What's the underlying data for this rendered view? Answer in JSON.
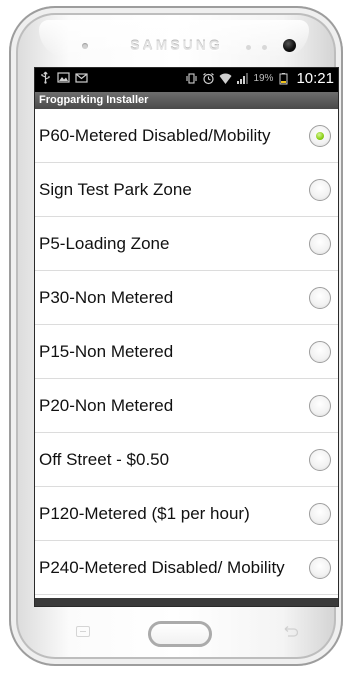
{
  "device": {
    "brand": "SAMSUNG"
  },
  "status_bar": {
    "left_icons": [
      "usb-icon",
      "image-icon",
      "mail-icon"
    ],
    "right_icons": [
      "vibrate-icon",
      "alarm-icon",
      "wifi-icon",
      "signal-icon",
      "battery-icon"
    ],
    "battery_percent": "19%",
    "time": "10:21"
  },
  "app": {
    "title": "Frogparking Installer"
  },
  "list": {
    "items": [
      {
        "label": "P60-Metered Disabled/Mobility",
        "selected": true
      },
      {
        "label": "Sign Test Park Zone",
        "selected": false
      },
      {
        "label": "P5-Loading Zone",
        "selected": false
      },
      {
        "label": "P30-Non Metered",
        "selected": false
      },
      {
        "label": "P15-Non Metered",
        "selected": false
      },
      {
        "label": "P20-Non Metered",
        "selected": false
      },
      {
        "label": "Off Street - $0.50",
        "selected": false
      },
      {
        "label": "P120-Metered ($1 per hour)",
        "selected": false
      },
      {
        "label": "P240-Metered Disabled/ Mobility",
        "selected": false
      }
    ]
  },
  "colors": {
    "selected_radio": "#8fd21c",
    "title_bar": "#5a5a5a",
    "status_bar": "#000000"
  }
}
